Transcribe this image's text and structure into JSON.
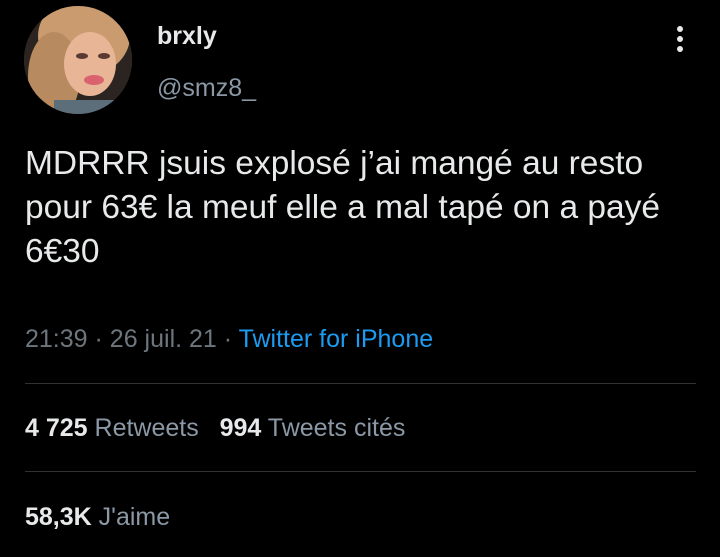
{
  "author": {
    "display_name": "brxly",
    "username": "@smz8_",
    "avatar_icon": "profile-photo"
  },
  "header": {
    "more_icon": "vertical-ellipsis-icon"
  },
  "tweet": {
    "text": "MDRRR jsuis explosé j’ai mangé au resto pour 63€ la meuf elle a mal tapé on a payé 6€30",
    "time": "21:39",
    "separator": "·",
    "date": "26 juil. 21",
    "source": "Twitter for iPhone"
  },
  "stats": {
    "retweets_count": "4 725",
    "retweets_label": "Retweets",
    "quotes_count": "994",
    "quotes_label": "Tweets cités",
    "likes_count": "58,3K",
    "likes_label": "J'aime"
  },
  "colors": {
    "background": "#000000",
    "text_primary": "#e7e9ea",
    "text_secondary": "#6e767d",
    "link": "#1d9bf0",
    "divider": "#2f3336"
  }
}
